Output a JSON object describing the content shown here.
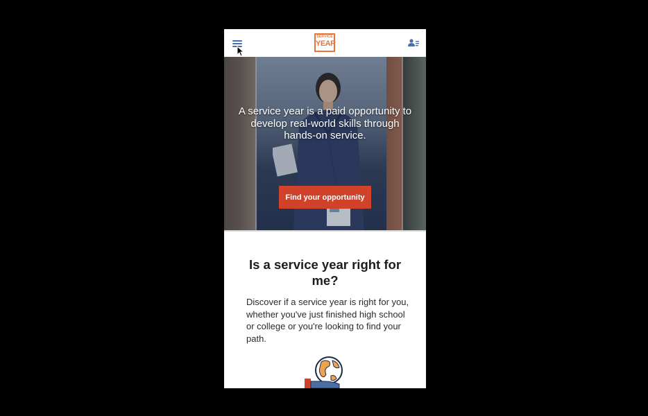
{
  "header": {
    "menu_icon": "hamburger-menu-icon",
    "logo": {
      "line1": "SERVICE",
      "line2": "YEAR",
      "color": "#e8743b"
    },
    "account_icon": "user-list-icon"
  },
  "hero": {
    "headline": "A service year is a paid opportunity to develop real-world skills through hands-on service.",
    "cta_label": "Find your opportunity",
    "cta_color": "#d0432a"
  },
  "section": {
    "title": "Is a service year right for me?",
    "body": "Discover if a service year is right for you, whether you've just finished high school or college or you're looking to find your path.",
    "illustration": "globe-hand-icon"
  }
}
